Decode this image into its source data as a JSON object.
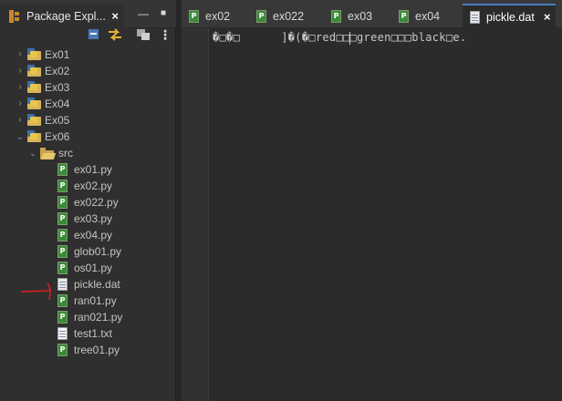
{
  "package_explorer": {
    "tab_title": "Package Expl...",
    "close_label": "×",
    "minimize_label": "—",
    "maximize_label": "■",
    "menu_label": "⋮"
  },
  "tree": {
    "projects": [
      {
        "label": "Ex01",
        "expanded": false
      },
      {
        "label": "Ex02",
        "expanded": false
      },
      {
        "label": "Ex03",
        "expanded": false
      },
      {
        "label": "Ex04",
        "expanded": false
      },
      {
        "label": "Ex05",
        "expanded": false
      },
      {
        "label": "Ex06",
        "expanded": true
      }
    ],
    "src_label": "src",
    "files": [
      {
        "label": "ex01.py",
        "kind": "python"
      },
      {
        "label": "ex02.py",
        "kind": "python"
      },
      {
        "label": "ex022.py",
        "kind": "python"
      },
      {
        "label": "ex03.py",
        "kind": "python"
      },
      {
        "label": "ex04.py",
        "kind": "python"
      },
      {
        "label": "glob01.py",
        "kind": "python"
      },
      {
        "label": "os01.py",
        "kind": "python"
      },
      {
        "label": "pickle.dat",
        "kind": "data"
      },
      {
        "label": "ran01.py",
        "kind": "python"
      },
      {
        "label": "ran021.py",
        "kind": "python"
      },
      {
        "label": "test1.txt",
        "kind": "text"
      },
      {
        "label": "tree01.py",
        "kind": "python"
      }
    ]
  },
  "editor": {
    "tabs": [
      {
        "label": "ex02",
        "kind": "python",
        "active": false
      },
      {
        "label": "ex022",
        "kind": "python",
        "active": false
      },
      {
        "label": "ex03",
        "kind": "python",
        "active": false
      },
      {
        "label": "ex04",
        "kind": "python",
        "active": false
      },
      {
        "label": "pickle.dat",
        "kind": "data",
        "active": true
      }
    ],
    "active_close_label": "×",
    "content_line": "�□�□      ]�(�□red□□□green□□□black□e."
  },
  "colors": {
    "annotation_red": "#e01b1b",
    "python_badge": "#3a8a3a",
    "folder": "#d9b45a",
    "active_tab_accent": "#4a7dc0"
  }
}
